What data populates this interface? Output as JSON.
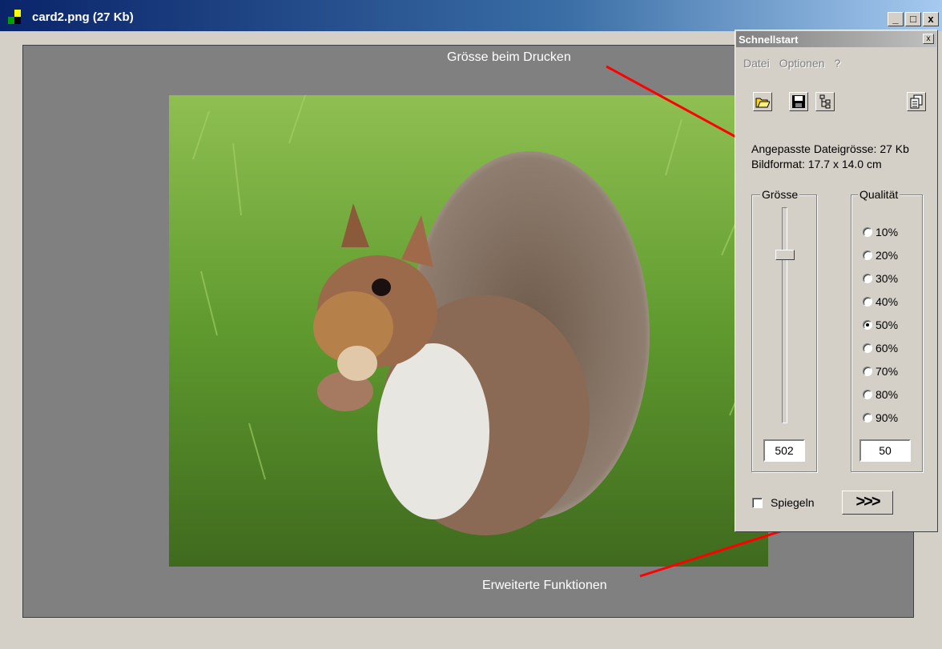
{
  "window": {
    "title": "card2.png (27 Kb)",
    "buttons": {
      "minimize": "_",
      "maximize": "□",
      "close": "x"
    }
  },
  "canvas": {
    "print_size_label": "Grösse beim Drucken",
    "advanced_label": "Erweiterte Funktionen"
  },
  "panel": {
    "title": "Schnellstart",
    "close": "x",
    "menu": [
      "Datei",
      "Optionen",
      "?"
    ],
    "tools": [
      "open-icon",
      "save-icon",
      "tree-icon",
      "copy-icon"
    ],
    "info": {
      "filesize": "Angepasste Dateigrösse: 27 Kb",
      "format": "Bildformat: 17.7 x 14.0 cm"
    },
    "size_group": {
      "title": "Grösse",
      "value": "502"
    },
    "quality_group": {
      "title": "Qualität",
      "options": [
        "10%",
        "20%",
        "30%",
        "40%",
        "50%",
        "60%",
        "70%",
        "80%",
        "90%"
      ],
      "selected": "50%",
      "value": "50"
    },
    "mirror_label": "Spiegeln",
    "advanced_button": ">>>"
  },
  "colors": {
    "annotation": "#ff0000",
    "titlebar": "#0a246a",
    "canvas": "#808080"
  }
}
